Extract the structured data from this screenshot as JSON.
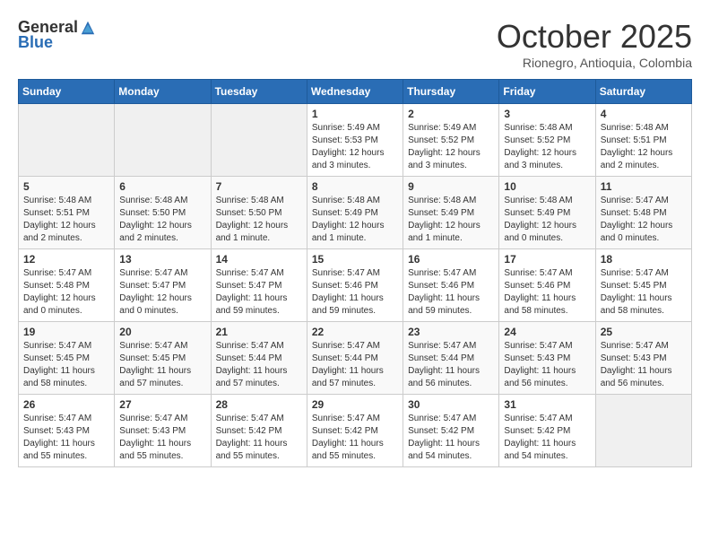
{
  "header": {
    "logo_general": "General",
    "logo_blue": "Blue",
    "month_title": "October 2025",
    "location": "Rionegro, Antioquia, Colombia"
  },
  "days_of_week": [
    "Sunday",
    "Monday",
    "Tuesday",
    "Wednesday",
    "Thursday",
    "Friday",
    "Saturday"
  ],
  "weeks": [
    [
      {
        "day": "",
        "info": ""
      },
      {
        "day": "",
        "info": ""
      },
      {
        "day": "",
        "info": ""
      },
      {
        "day": "1",
        "info": "Sunrise: 5:49 AM\nSunset: 5:53 PM\nDaylight: 12 hours\nand 3 minutes."
      },
      {
        "day": "2",
        "info": "Sunrise: 5:49 AM\nSunset: 5:52 PM\nDaylight: 12 hours\nand 3 minutes."
      },
      {
        "day": "3",
        "info": "Sunrise: 5:48 AM\nSunset: 5:52 PM\nDaylight: 12 hours\nand 3 minutes."
      },
      {
        "day": "4",
        "info": "Sunrise: 5:48 AM\nSunset: 5:51 PM\nDaylight: 12 hours\nand 2 minutes."
      }
    ],
    [
      {
        "day": "5",
        "info": "Sunrise: 5:48 AM\nSunset: 5:51 PM\nDaylight: 12 hours\nand 2 minutes."
      },
      {
        "day": "6",
        "info": "Sunrise: 5:48 AM\nSunset: 5:50 PM\nDaylight: 12 hours\nand 2 minutes."
      },
      {
        "day": "7",
        "info": "Sunrise: 5:48 AM\nSunset: 5:50 PM\nDaylight: 12 hours\nand 1 minute."
      },
      {
        "day": "8",
        "info": "Sunrise: 5:48 AM\nSunset: 5:49 PM\nDaylight: 12 hours\nand 1 minute."
      },
      {
        "day": "9",
        "info": "Sunrise: 5:48 AM\nSunset: 5:49 PM\nDaylight: 12 hours\nand 1 minute."
      },
      {
        "day": "10",
        "info": "Sunrise: 5:48 AM\nSunset: 5:49 PM\nDaylight: 12 hours\nand 0 minutes."
      },
      {
        "day": "11",
        "info": "Sunrise: 5:47 AM\nSunset: 5:48 PM\nDaylight: 12 hours\nand 0 minutes."
      }
    ],
    [
      {
        "day": "12",
        "info": "Sunrise: 5:47 AM\nSunset: 5:48 PM\nDaylight: 12 hours\nand 0 minutes."
      },
      {
        "day": "13",
        "info": "Sunrise: 5:47 AM\nSunset: 5:47 PM\nDaylight: 12 hours\nand 0 minutes."
      },
      {
        "day": "14",
        "info": "Sunrise: 5:47 AM\nSunset: 5:47 PM\nDaylight: 11 hours\nand 59 minutes."
      },
      {
        "day": "15",
        "info": "Sunrise: 5:47 AM\nSunset: 5:46 PM\nDaylight: 11 hours\nand 59 minutes."
      },
      {
        "day": "16",
        "info": "Sunrise: 5:47 AM\nSunset: 5:46 PM\nDaylight: 11 hours\nand 59 minutes."
      },
      {
        "day": "17",
        "info": "Sunrise: 5:47 AM\nSunset: 5:46 PM\nDaylight: 11 hours\nand 58 minutes."
      },
      {
        "day": "18",
        "info": "Sunrise: 5:47 AM\nSunset: 5:45 PM\nDaylight: 11 hours\nand 58 minutes."
      }
    ],
    [
      {
        "day": "19",
        "info": "Sunrise: 5:47 AM\nSunset: 5:45 PM\nDaylight: 11 hours\nand 58 minutes."
      },
      {
        "day": "20",
        "info": "Sunrise: 5:47 AM\nSunset: 5:45 PM\nDaylight: 11 hours\nand 57 minutes."
      },
      {
        "day": "21",
        "info": "Sunrise: 5:47 AM\nSunset: 5:44 PM\nDaylight: 11 hours\nand 57 minutes."
      },
      {
        "day": "22",
        "info": "Sunrise: 5:47 AM\nSunset: 5:44 PM\nDaylight: 11 hours\nand 57 minutes."
      },
      {
        "day": "23",
        "info": "Sunrise: 5:47 AM\nSunset: 5:44 PM\nDaylight: 11 hours\nand 56 minutes."
      },
      {
        "day": "24",
        "info": "Sunrise: 5:47 AM\nSunset: 5:43 PM\nDaylight: 11 hours\nand 56 minutes."
      },
      {
        "day": "25",
        "info": "Sunrise: 5:47 AM\nSunset: 5:43 PM\nDaylight: 11 hours\nand 56 minutes."
      }
    ],
    [
      {
        "day": "26",
        "info": "Sunrise: 5:47 AM\nSunset: 5:43 PM\nDaylight: 11 hours\nand 55 minutes."
      },
      {
        "day": "27",
        "info": "Sunrise: 5:47 AM\nSunset: 5:43 PM\nDaylight: 11 hours\nand 55 minutes."
      },
      {
        "day": "28",
        "info": "Sunrise: 5:47 AM\nSunset: 5:42 PM\nDaylight: 11 hours\nand 55 minutes."
      },
      {
        "day": "29",
        "info": "Sunrise: 5:47 AM\nSunset: 5:42 PM\nDaylight: 11 hours\nand 55 minutes."
      },
      {
        "day": "30",
        "info": "Sunrise: 5:47 AM\nSunset: 5:42 PM\nDaylight: 11 hours\nand 54 minutes."
      },
      {
        "day": "31",
        "info": "Sunrise: 5:47 AM\nSunset: 5:42 PM\nDaylight: 11 hours\nand 54 minutes."
      },
      {
        "day": "",
        "info": ""
      }
    ]
  ]
}
